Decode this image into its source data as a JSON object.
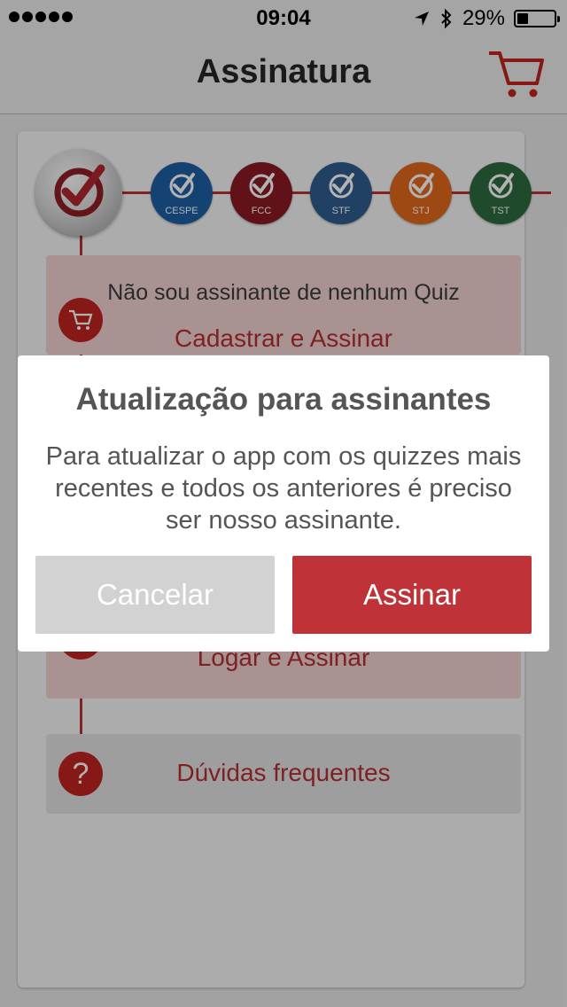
{
  "status_bar": {
    "time": "09:04",
    "battery_percent": "29%",
    "battery_level": 0.29,
    "signal_bars": 5
  },
  "nav": {
    "title": "Assinatura",
    "cart_icon": "cart-icon"
  },
  "quizzes": [
    {
      "label": "CESPE",
      "color": "#1c5fa5"
    },
    {
      "label": "FCC",
      "color": "#8b1a24"
    },
    {
      "label": "STF",
      "color": "#2f5d8e"
    },
    {
      "label": "STJ",
      "color": "#e2691e"
    },
    {
      "label": "TST",
      "color": "#2e6a3f"
    }
  ],
  "cards": {
    "new_subscriber": {
      "description": "Não sou assinante de nenhum Quiz",
      "link": "Cadastrar e Assinar"
    },
    "existing_subscriber": {
      "link": "Logar e Assinar"
    },
    "faq": {
      "link": "Dúvidas frequentes",
      "icon_text": "?"
    }
  },
  "alert": {
    "title": "Atualização para assinantes",
    "message": "Para atualizar o app com os quizzes mais recentes e todos os anteriores é preciso ser nosso assinante.",
    "cancel_label": "Cancelar",
    "confirm_label": "Assinar"
  },
  "colors": {
    "accent": "#b72f33",
    "button_confirm": "#bf3338",
    "button_cancel": "#d2d2d2"
  }
}
